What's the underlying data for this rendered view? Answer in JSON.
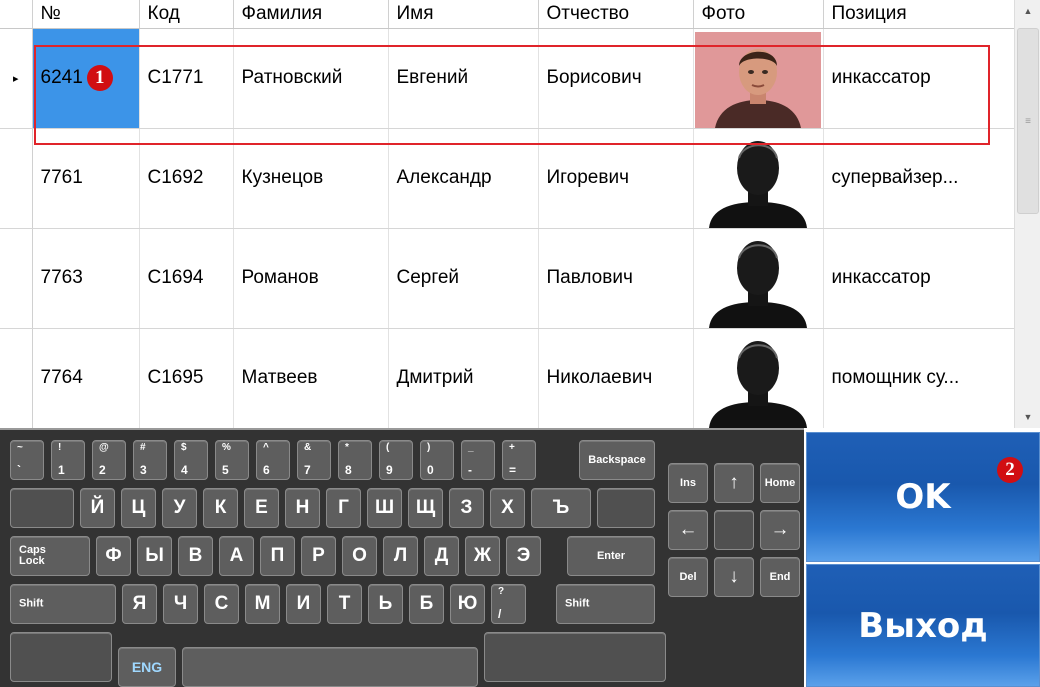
{
  "grid": {
    "columns": [
      "№",
      "Код",
      "Фамилия",
      "Имя",
      "Отчество",
      "Фото",
      "Позиция"
    ],
    "rows": [
      {
        "num": "6241",
        "code": "C1771",
        "last": "Ратновский",
        "first": "Евгений",
        "middle": "Борисович",
        "photo": "person-photo",
        "position": "инкассатор"
      },
      {
        "num": "7761",
        "code": "C1692",
        "last": "Кузнецов",
        "first": "Александр",
        "middle": "Игоревич",
        "photo": "silhouette-icon",
        "position": "супервайзер..."
      },
      {
        "num": "7763",
        "code": "C1694",
        "last": "Романов",
        "first": "Сергей",
        "middle": "Павлович",
        "photo": "silhouette-icon",
        "position": "инкассатор"
      },
      {
        "num": "7764",
        "code": "C1695",
        "last": "Матвеев",
        "first": "Дмитрий",
        "middle": "Николаевич",
        "photo": "silhouette-icon",
        "position": "помощник су..."
      }
    ],
    "current_row_indicator": "▸",
    "selected_row": 0
  },
  "markers": {
    "one": "1",
    "two": "2"
  },
  "keyboard": {
    "row1": [
      {
        "top": "~",
        "bottom": "`"
      },
      {
        "top": "!",
        "bottom": "1"
      },
      {
        "top": "@",
        "bottom": "2"
      },
      {
        "top": "#",
        "bottom": "3"
      },
      {
        "top": "$",
        "bottom": "4"
      },
      {
        "top": "%",
        "bottom": "5"
      },
      {
        "top": "^",
        "bottom": "6"
      },
      {
        "top": "&",
        "bottom": "7"
      },
      {
        "top": "*",
        "bottom": "8"
      },
      {
        "top": "(",
        "bottom": "9"
      },
      {
        "top": ")",
        "bottom": "0"
      },
      {
        "top": "_",
        "bottom": "-"
      },
      {
        "top": "+",
        "bottom": "="
      }
    ],
    "backspace": "Backspace",
    "row2": [
      "Й",
      "Ц",
      "У",
      "К",
      "Е",
      "Н",
      "Г",
      "Ш",
      "Щ",
      "З",
      "Х",
      "Ъ"
    ],
    "caps": "Caps\nLock",
    "row3": [
      "Ф",
      "Ы",
      "В",
      "А",
      "П",
      "Р",
      "О",
      "Л",
      "Д",
      "Ж",
      "Э"
    ],
    "enter": "Enter",
    "shift": "Shift",
    "row4": [
      "Я",
      "Ч",
      "С",
      "М",
      "И",
      "Т",
      "Ь",
      "Б",
      "Ю"
    ],
    "question": {
      "top": "?",
      "bottom": "/"
    },
    "lang": "ENG",
    "nav": {
      "ins": "Ins",
      "home": "Home",
      "del": "Del",
      "end": "End"
    }
  },
  "buttons": {
    "ok": "OK",
    "exit": "Выход"
  },
  "colors": {
    "selection": "#3c94e8",
    "highlight_border": "#e0242a",
    "marker": "#d10e12",
    "button": "#1f5fb6"
  }
}
